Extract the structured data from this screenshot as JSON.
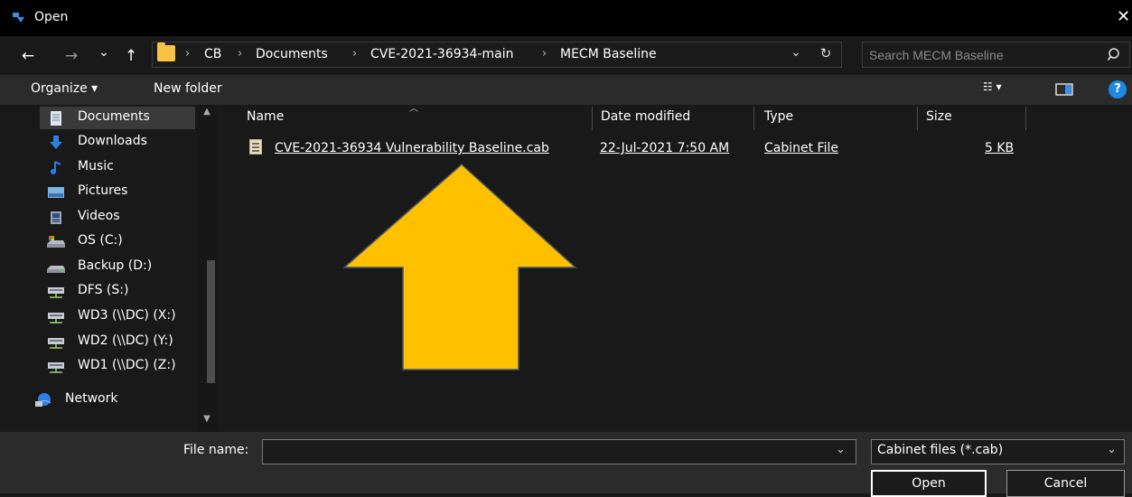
{
  "window": {
    "title": "Open",
    "close_glyph": "✕"
  },
  "address_bar": {
    "back_glyph": "←",
    "forward_glyph": "→",
    "recent_glyph": "⌄",
    "up_glyph": "↑",
    "breadcrumbs": [
      "CB",
      "Documents",
      "CVE-2021-36934-main",
      "MECM Baseline"
    ],
    "separator": "›",
    "dropdown_glyph": "⌄",
    "refresh_glyph": "↻"
  },
  "search": {
    "placeholder": "Search MECM Baseline",
    "icon": "search-icon"
  },
  "toolbar": {
    "organize_label": "Organize ▾",
    "new_folder_label": "New folder",
    "view_glyph": "☷ ▾",
    "help_glyph": "?"
  },
  "nav": {
    "items": [
      {
        "label": "Documents",
        "icon": "documents-icon",
        "selected": true
      },
      {
        "label": "Downloads",
        "icon": "downloads-icon"
      },
      {
        "label": "Music",
        "icon": "music-icon"
      },
      {
        "label": "Pictures",
        "icon": "pictures-icon"
      },
      {
        "label": "Videos",
        "icon": "videos-icon"
      },
      {
        "label": "OS (C:)",
        "icon": "os-drive-icon"
      },
      {
        "label": "Backup (D:)",
        "icon": "backup-drive-icon"
      },
      {
        "label": "DFS (S:)",
        "icon": "network-drive-icon"
      },
      {
        "label": "WD3 (\\\\DC) (X:)",
        "icon": "network-drive-icon"
      },
      {
        "label": "WD2 (\\\\DC) (Y:)",
        "icon": "network-drive-icon"
      },
      {
        "label": "WD1 (\\\\DC) (Z:)",
        "icon": "network-drive-icon"
      },
      {
        "label": "Network",
        "icon": "network-icon"
      }
    ]
  },
  "file_list": {
    "columns": {
      "name": "Name",
      "date": "Date modified",
      "type": "Type",
      "size": "Size"
    },
    "rows": [
      {
        "name": "CVE-2021-36934 Vulnerability Baseline.cab",
        "date": "22-Jul-2021 7:50 AM",
        "type": "Cabinet File",
        "size": "5 KB",
        "icon": "cabinet-file-icon"
      }
    ]
  },
  "annotation": {
    "arrow_color": "#FFC000",
    "arrow_stroke": "#44546A",
    "icon": "up-arrow-annotation"
  },
  "bottom": {
    "file_name_label": "File name:",
    "file_name_value": "",
    "filter_value": "Cabinet files (*.cab)",
    "open_label": "Open",
    "cancel_label": "Cancel"
  },
  "colors": {
    "background": "#191919",
    "toolbar": "#2B2B2B",
    "help_blue": "#1E88E5",
    "folder": "#F6C344"
  }
}
